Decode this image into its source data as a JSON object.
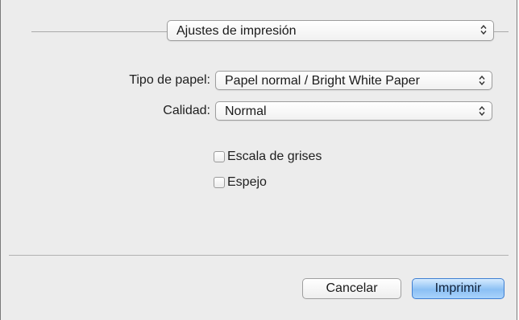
{
  "settings_popup": {
    "value": "Ajustes de impresión",
    "icon": "updown-arrows-icon"
  },
  "form": {
    "paper_type": {
      "label": "Tipo de papel:",
      "value": "Papel normal / Bright White Paper"
    },
    "quality": {
      "label": "Calidad:",
      "value": "Normal"
    },
    "grayscale": {
      "label": "Escala de grises",
      "checked": false
    },
    "mirror": {
      "label": "Espejo",
      "checked": false
    }
  },
  "buttons": {
    "cancel_label": "Cancelar",
    "print_label": "Imprimir"
  },
  "colors": {
    "dialog_background": "#ececec",
    "default_button": "#8cc0f4"
  }
}
